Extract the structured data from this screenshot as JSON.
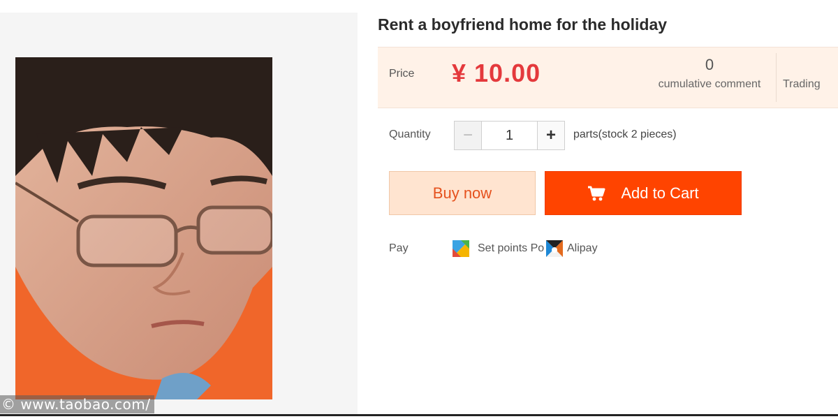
{
  "product": {
    "title": "Rent a boyfriend home for the holiday",
    "watermark": "© www.taobao.com/"
  },
  "price_panel": {
    "price_label": "Price",
    "price_value": "¥ 10.00",
    "comments_count": "0",
    "comments_label": "cumulative comment",
    "trading_count": "-",
    "trading_label": "Trading"
  },
  "quantity": {
    "label": "Quantity",
    "minus": "−",
    "value": "1",
    "plus": "+",
    "stock_text": "parts(stock 2 pieces)"
  },
  "actions": {
    "buy_now": "Buy now",
    "add_to_cart": "Add to Cart"
  },
  "payment": {
    "label": "Pay",
    "methods": [
      {
        "label": "Set points Po",
        "icon": "points-icon"
      },
      {
        "label": "Alipay",
        "icon": "alipay-icon"
      }
    ]
  },
  "colors": {
    "accent": "#ff4400",
    "price": "#e4393c",
    "buy_bg": "#ffe4d0",
    "price_panel_bg": "#fff2e8"
  }
}
